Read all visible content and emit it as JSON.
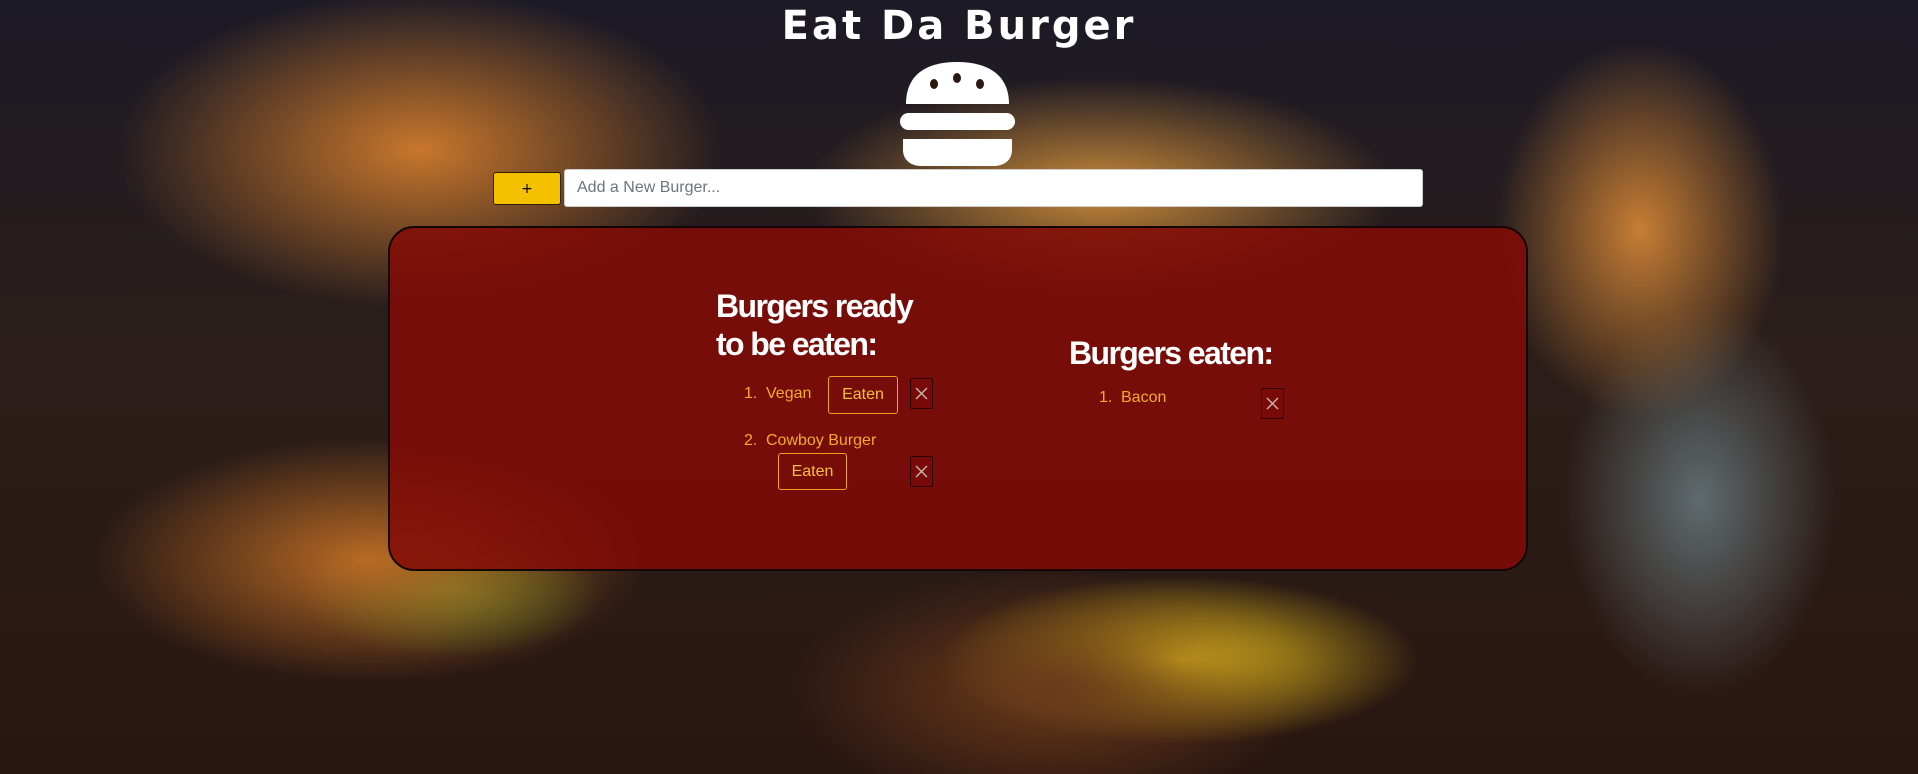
{
  "header": {
    "title": "Eat Da Burger",
    "logo_icon": "burger-icon"
  },
  "form": {
    "add_button_label": "+",
    "input_placeholder": "Add a New Burger...",
    "input_value": ""
  },
  "lists": {
    "ready": {
      "heading": "Burgers ready to be eaten:",
      "items": [
        {
          "number": "1.",
          "name": "Vegan",
          "eaten_label": "Eaten",
          "delete_icon": "close-icon"
        },
        {
          "number": "2.",
          "name": "Cowboy Burger",
          "eaten_label": "Eaten",
          "delete_icon": "close-icon"
        }
      ]
    },
    "eaten": {
      "heading": "Burgers eaten:",
      "items": [
        {
          "number": "1.",
          "name": "Bacon",
          "delete_icon": "close-icon"
        }
      ]
    }
  },
  "colors": {
    "panel": "#820a06",
    "accent_yellow": "#f5c000",
    "item_text": "#f5a92a",
    "heading_text": "#ffffff"
  }
}
